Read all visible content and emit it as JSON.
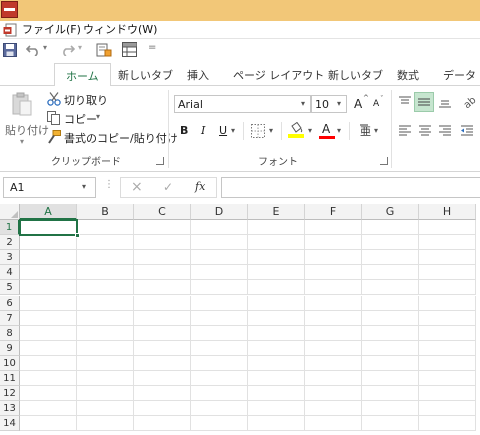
{
  "menubar": {
    "items": [
      {
        "label": "ファイル(F)"
      },
      {
        "label": "ウィンドウ(W)"
      }
    ]
  },
  "quick_access": {
    "more": "="
  },
  "tabs": [
    {
      "label": "ホーム",
      "active": true
    },
    {
      "label": "新しいタブ"
    },
    {
      "label": "挿入"
    },
    {
      "label": "ページ レイアウト"
    },
    {
      "label": "新しいタブ"
    },
    {
      "label": "数式"
    },
    {
      "label": "データ"
    }
  ],
  "clipboard": {
    "paste_label": "貼り付け",
    "cut_label": "切り取り",
    "copy_label": "コピー",
    "format_painter_label": "書式のコピー/貼り付け",
    "group_label": "クリップボード"
  },
  "font": {
    "font_name": "Arial",
    "font_size": "10",
    "bold": "B",
    "italic": "I",
    "underline": "U",
    "font_color_letter": "A",
    "grow_letter": "A",
    "shrink_letter": "A",
    "group_label": "フォント",
    "fill_color": "#ffff00",
    "font_color": "#ff0000"
  },
  "formula_bar": {
    "name_box": "A1",
    "fx": "fx",
    "cancel": "×",
    "enter": "✓"
  },
  "sheet": {
    "columns": [
      "A",
      "B",
      "C",
      "D",
      "E",
      "F",
      "G",
      "H"
    ],
    "rows": [
      "1",
      "2",
      "3",
      "4",
      "5",
      "6",
      "7",
      "8",
      "9",
      "10",
      "11",
      "12",
      "13",
      "14"
    ],
    "selected_cell": "A1"
  },
  "colors": {
    "titlebar": "#f2c778",
    "accent": "#217346",
    "align_active": "#c6e5cf"
  }
}
